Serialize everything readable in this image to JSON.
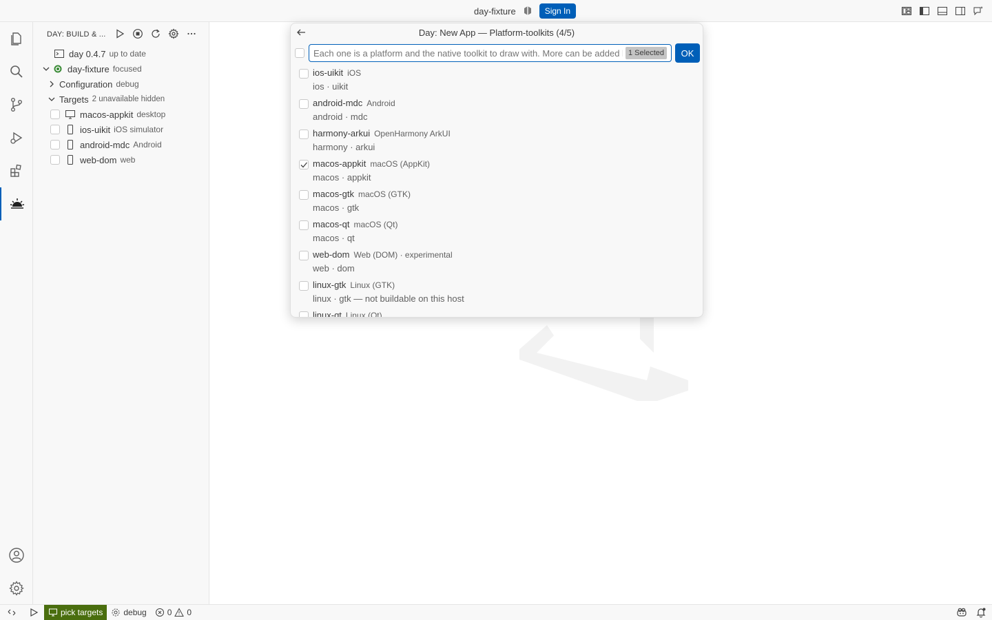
{
  "window": {
    "title": "day-fixture",
    "sign_in_label": "Sign In"
  },
  "titlebar_icons": [
    "layout-customize-icon",
    "toggle-primary-sidebar-icon",
    "toggle-panel-icon",
    "toggle-secondary-sidebar-icon",
    "chat-feedback-icon"
  ],
  "activity_bar": {
    "items": [
      "explorer-icon",
      "search-icon",
      "source-control-icon",
      "run-debug-icon",
      "extensions-icon",
      "day-extension-icon"
    ],
    "bottom": [
      "accounts-icon",
      "manage-gear-icon"
    ],
    "active": "day-extension-icon"
  },
  "sidebar": {
    "title": "DAY: BUILD & ...",
    "actions": [
      "run-icon",
      "stop-icon",
      "refresh-icon",
      "settings-icon",
      "more-icon"
    ],
    "tree": {
      "version": {
        "label": "day 0.4.7",
        "desc": "up to date"
      },
      "project": {
        "label": "day-fixture",
        "desc": "focused"
      },
      "configuration": {
        "label": "Configuration",
        "desc": "debug"
      },
      "targets": {
        "label": "Targets",
        "desc": "2 unavailable hidden"
      },
      "target_items": [
        {
          "label": "macos-appkit",
          "desc": "desktop",
          "icon": "desktop-icon"
        },
        {
          "label": "ios-uikit",
          "desc": "iOS simulator",
          "icon": "phone-icon"
        },
        {
          "label": "android-mdc",
          "desc": "Android",
          "icon": "phone-icon"
        },
        {
          "label": "web-dom",
          "desc": "web",
          "icon": "phone-icon"
        }
      ]
    }
  },
  "quick_pick": {
    "title": "Day: New App — Platform-toolkits (4/5)",
    "input_value": "Each one is a platform and the native toolkit to draw with. More can be added later.",
    "selected_count": "1 Selected",
    "ok_label": "OK",
    "items": [
      {
        "label": "ios-uikit",
        "desc": "iOS",
        "detail": "ios · uikit",
        "checked": false
      },
      {
        "label": "android-mdc",
        "desc": "Android",
        "detail": "android · mdc",
        "checked": false
      },
      {
        "label": "harmony-arkui",
        "desc": "OpenHarmony ArkUI",
        "detail": "harmony · arkui",
        "checked": false
      },
      {
        "label": "macos-appkit",
        "desc": "macOS (AppKit)",
        "detail": "macos · appkit",
        "checked": true
      },
      {
        "label": "macos-gtk",
        "desc": "macOS (GTK)",
        "detail": "macos · gtk",
        "checked": false
      },
      {
        "label": "macos-qt",
        "desc": "macOS (Qt)",
        "detail": "macos · qt",
        "checked": false
      },
      {
        "label": "web-dom",
        "desc": "Web (DOM) · experimental",
        "detail": "web · dom",
        "checked": false
      },
      {
        "label": "linux-gtk",
        "desc": "Linux (GTK)",
        "detail": "linux · gtk — not buildable on this host",
        "checked": false
      },
      {
        "label": "linux-qt",
        "desc": "Linux (Qt)",
        "detail": "",
        "checked": false
      }
    ]
  },
  "status_bar": {
    "pick_targets": "pick targets",
    "config": "debug",
    "errors": "0",
    "warnings": "0"
  },
  "colors": {
    "accent": "#005fb8",
    "status_highlight": "#4a6e0e",
    "running_dot": "#388a34"
  }
}
